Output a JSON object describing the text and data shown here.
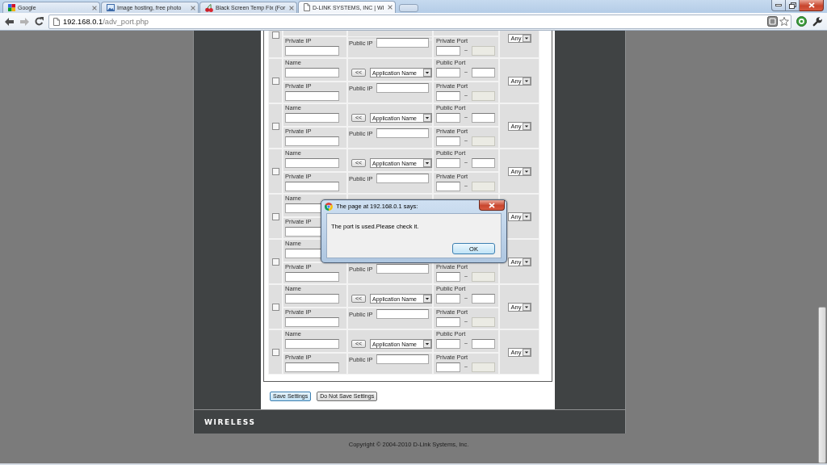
{
  "browser": {
    "tabs": [
      {
        "kind": "tiles",
        "title": "Google",
        "selected": false
      },
      {
        "kind": "picture",
        "title": "Image hosting, free photo",
        "selected": false
      },
      {
        "kind": "cherries",
        "title": "Black Screen Temp Fix (For",
        "selected": false
      },
      {
        "kind": "page",
        "title": "D-LINK SYSTEMS, INC | WI",
        "selected": true
      }
    ],
    "toolbar": {
      "back": {
        "disabled": false
      },
      "forward": {
        "disabled": true
      },
      "url": {
        "host": "192.168.0.1",
        "path": "/adv_port.php"
      },
      "bookmarked": false
    }
  },
  "page": {
    "rows": [
      {
        "checked": false,
        "private_ip": {
          "label": "Private IP"
        },
        "public_ip": {
          "label": "Public IP"
        },
        "private_port": {
          "label": "Private Port",
          "separator": "~",
          "end_disabled": true
        },
        "protocol": "Any"
      },
      {
        "checked": false,
        "name": {
          "label": "Name"
        },
        "private_ip": {
          "label": "Private IP"
        },
        "application": {
          "button": "<<",
          "select": "Application Name"
        },
        "public_ip": {
          "label": "Public IP"
        },
        "public_port": {
          "label": "Public Port",
          "separator": "~",
          "end_disabled": false
        },
        "private_port": {
          "label": "Private Port",
          "separator": "~",
          "end_disabled": true
        },
        "protocol": "Any"
      },
      {
        "checked": false,
        "name": {
          "label": "Name"
        },
        "private_ip": {
          "label": "Private IP"
        },
        "application": {
          "button": "<<",
          "select": "Application Name"
        },
        "public_ip": {
          "label": "Public IP"
        },
        "public_port": {
          "label": "Public Port",
          "separator": "~",
          "end_disabled": false
        },
        "private_port": {
          "label": "Private Port",
          "separator": "~",
          "end_disabled": true
        },
        "protocol": "Any"
      },
      {
        "checked": false,
        "name": {
          "label": "Name"
        },
        "private_ip": {
          "label": "Private IP"
        },
        "application": {
          "button": "<<",
          "select": "Application Name"
        },
        "public_ip": {
          "label": "Public IP"
        },
        "public_port": {
          "label": "Public Port",
          "separator": "~",
          "end_disabled": false
        },
        "private_port": {
          "label": "Private Port",
          "separator": "~",
          "end_disabled": true
        },
        "protocol": "Any"
      },
      {
        "checked": false,
        "name": {
          "label": "Name"
        },
        "private_ip": {
          "label": "Private IP"
        },
        "protocol": "Any"
      },
      {
        "checked": false,
        "name": {
          "label": "Name"
        },
        "private_ip": {
          "label": "Private IP"
        },
        "public_ip": {
          "label": "Public IP"
        },
        "private_port": {
          "label": "Private Port",
          "separator": "~",
          "end_disabled": true
        },
        "protocol": "Any"
      },
      {
        "checked": false,
        "name": {
          "label": "Name"
        },
        "private_ip": {
          "label": "Private IP"
        },
        "application": {
          "button": "<<",
          "select": "Application Name"
        },
        "public_ip": {
          "label": "Public IP"
        },
        "public_port": {
          "label": "Public Port",
          "separator": "~",
          "end_disabled": false
        },
        "private_port": {
          "label": "Private Port",
          "separator": "~",
          "end_disabled": true
        },
        "protocol": "Any"
      },
      {
        "checked": false,
        "name": {
          "label": "Name"
        },
        "private_ip": {
          "label": "Private IP"
        },
        "application": {
          "button": "<<",
          "select": "Application Name"
        },
        "public_ip": {
          "label": "Public IP"
        },
        "public_port": {
          "label": "Public Port",
          "separator": "~",
          "end_disabled": false
        },
        "private_port": {
          "label": "Private Port",
          "separator": "~",
          "end_disabled": true
        },
        "protocol": "Any"
      }
    ],
    "buttons": [
      {
        "label": "Save Settings",
        "focused": true
      },
      {
        "label": "Do Not Save Settings",
        "focused": false
      }
    ],
    "footer_logo": "WIRELESS",
    "copyright": "Copyright © 2004-2010 D-Link Systems, Inc."
  },
  "dialog": {
    "title": "The page at 192.168.0.1 says:",
    "message": "The port is used.Please check it.",
    "buttons": [
      {
        "label": "OK",
        "focused": true
      }
    ]
  }
}
